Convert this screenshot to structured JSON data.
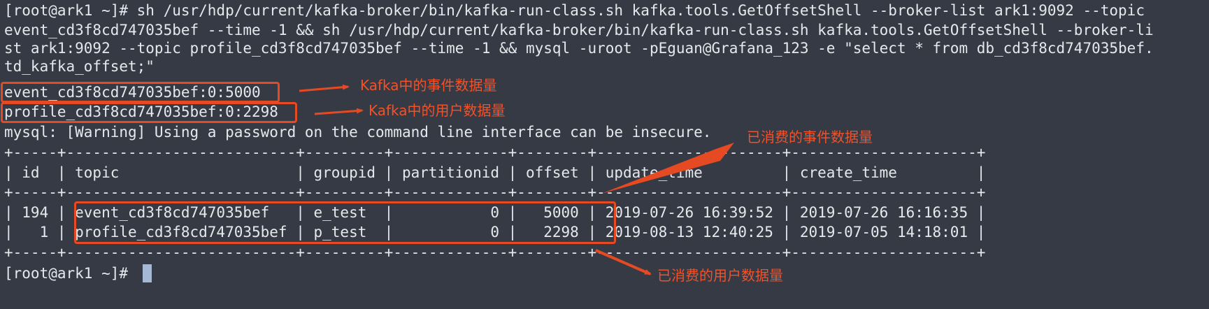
{
  "terminal": {
    "lines": [
      "[root@ark1 ~]# sh /usr/hdp/current/kafka-broker/bin/kafka-run-class.sh kafka.tools.GetOffsetShell --broker-list ark1:9092 --topic",
      "event_cd3f8cd747035bef --time -1 && sh /usr/hdp/current/kafka-broker/bin/kafka-run-class.sh kafka.tools.GetOffsetShell --broker-li",
      "st ark1:9092 --topic profile_cd3f8cd747035bef --time -1 && mysql -uroot -pEguan@Grafana_123 -e \"select * from db_cd3f8cd747035bef.",
      "td_kafka_offset;\"",
      "event_cd3f8cd747035bef:0:5000",
      "profile_cd3f8cd747035bef:0:2298",
      "mysql: [Warning] Using a password on the command line interface can be insecure.",
      "+-----+--------------------------+---------+-------------+--------+---------------------+---------------------+",
      "| id  | topic                    | groupid | partitionid | offset | update_time         | create_time         |",
      "+-----+--------------------------+---------+-------------+--------+---------------------+---------------------+",
      "| 194 | event_cd3f8cd747035bef   | e_test  |           0 |   5000 | 2019-07-26 16:39:52 | 2019-07-26 16:16:35 |",
      "|   1 | profile_cd3f8cd747035bef | p_test  |           0 |   2298 | 2019-08-13 12:40:25 | 2019-07-05 14:18:01 |",
      "+-----+--------------------------+---------+-------------+--------+---------------------+---------------------+",
      "[root@ark1 ~]# "
    ]
  },
  "annotations": {
    "kafka_event": "Kafka中的事件数据量",
    "kafka_profile": "Kafka中的用户数据量",
    "consumed_event": "已消费的事件数据量",
    "consumed_profile": "已消费的用户数据量"
  },
  "colors": {
    "background": "#363a44",
    "text": "#e6e8ec",
    "annotation": "#f0522a",
    "cursor": "#a5b8d4"
  }
}
